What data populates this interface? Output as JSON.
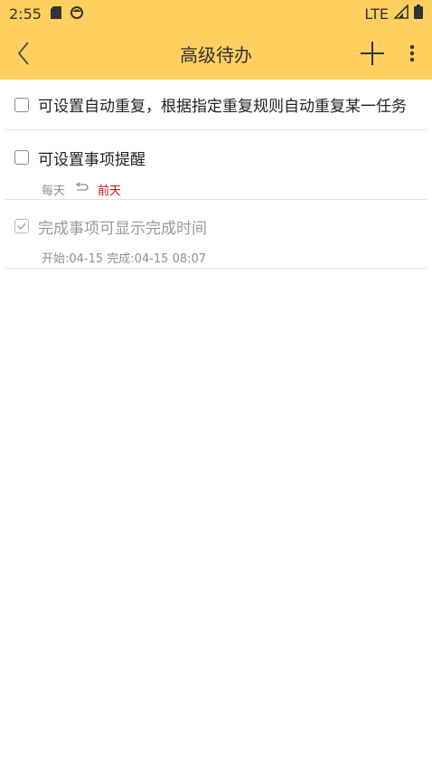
{
  "status_bar": {
    "time": "2:55",
    "network": "LTE"
  },
  "app_bar": {
    "title": "高级待办"
  },
  "items": [
    {
      "text": "可设置自动重复，根据指定重复规则自动重复某一任务",
      "checked": false
    },
    {
      "text": "可设置事项提醒",
      "checked": false,
      "repeat": "每天",
      "reminder": "前天"
    },
    {
      "text": "完成事项可显示完成时间",
      "checked": true,
      "times": "开始:04-15 完成:04-15 08:07"
    }
  ],
  "colors": {
    "appbar": "#FFD05F",
    "reminder": "#cc1111"
  }
}
